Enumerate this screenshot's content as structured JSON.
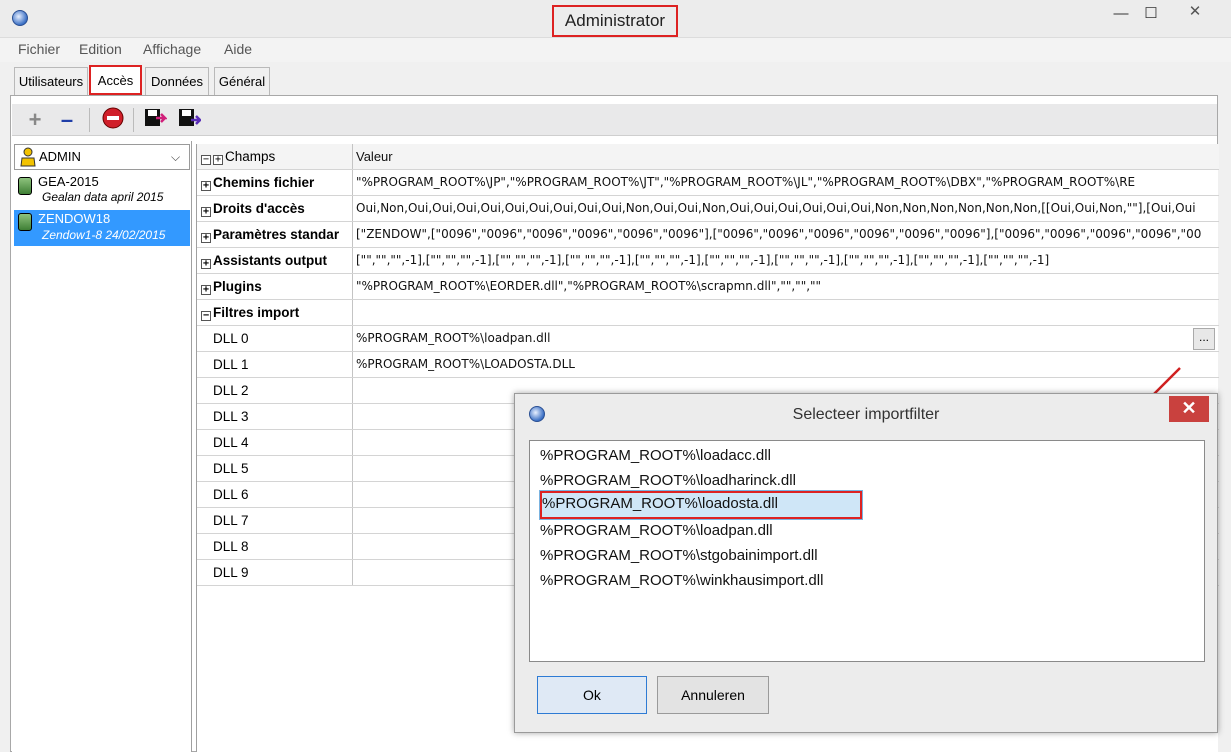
{
  "window": {
    "title": "Administrator",
    "minimize": "—",
    "maximize": "☐",
    "close": "✕"
  },
  "menu": [
    "Fichier",
    "Edition",
    "Affichage",
    "Aide"
  ],
  "tabs": [
    "Utilisateurs",
    "Accès",
    "Données",
    "Général"
  ],
  "toolbar": {
    "add": "+",
    "remove": "–",
    "stop": "⛔",
    "export1": "💾",
    "export2": "💾"
  },
  "left_panel": {
    "user": "ADMIN",
    "databases": [
      {
        "name": "GEA-2015",
        "sub": "Gealan data april 2015"
      },
      {
        "name": "ZENDOW18",
        "sub": "Zendow1-8 24/02/2015"
      }
    ]
  },
  "grid": {
    "header_field": "Champs",
    "header_value": "Valeur",
    "rows": [
      {
        "field": "Chemins fichier",
        "value": "\"%PROGRAM_ROOT%\\JP\",\"%PROGRAM_ROOT%\\JT\",\"%PROGRAM_ROOT%\\JL\",\"%PROGRAM_ROOT%\\DBX\",\"%PROGRAM_ROOT%\\RE"
      },
      {
        "field": "Droits d'accès",
        "value": "Oui,Non,Oui,Oui,Oui,Oui,Oui,Oui,Oui,Oui,Oui,Non,Oui,Oui,Non,Oui,Oui,Oui,Oui,Oui,Oui,Non,Non,Non,Non,Non,Non,[[Oui,Oui,Non,\"\"],[Oui,Oui"
      },
      {
        "field": "Paramètres standar",
        "value": "[\"ZENDOW\",[\"0096\",\"0096\",\"0096\",\"0096\",\"0096\",\"0096\"],[\"0096\",\"0096\",\"0096\",\"0096\",\"0096\",\"0096\"],[\"0096\",\"0096\",\"0096\",\"0096\",\"00"
      },
      {
        "field": "Assistants output",
        "value": "[\"\",\"\",\"\",-1],[\"\",\"\",\"\",-1],[\"\",\"\",\"\",-1],[\"\",\"\",\"\",-1],[\"\",\"\",\"\",-1],[\"\",\"\",\"\",-1],[\"\",\"\",\"\",-1],[\"\",\"\",\"\",-1],[\"\",\"\",\"\",-1],[\"\",\"\",\"\",-1]"
      },
      {
        "field": "Plugins",
        "value": "\"%PROGRAM_ROOT%\\EORDER.dll\",\"%PROGRAM_ROOT%\\scrapmn.dll\",\"\",\"\",\"\""
      },
      {
        "field": "Filtres import",
        "value": ""
      }
    ],
    "dlls": [
      {
        "field": "DLL 0",
        "value": "%PROGRAM_ROOT%\\loadpan.dll"
      },
      {
        "field": "DLL 1",
        "value": "%PROGRAM_ROOT%\\LOADOSTA.DLL"
      },
      {
        "field": "DLL 2",
        "value": ""
      },
      {
        "field": "DLL 3",
        "value": ""
      },
      {
        "field": "DLL 4",
        "value": ""
      },
      {
        "field": "DLL 5",
        "value": ""
      },
      {
        "field": "DLL 6",
        "value": ""
      },
      {
        "field": "DLL 7",
        "value": ""
      },
      {
        "field": "DLL 8",
        "value": ""
      },
      {
        "field": "DLL 9",
        "value": ""
      }
    ],
    "ellipsis": "..."
  },
  "dialog": {
    "title": "Selecteer importfilter",
    "close": "✕",
    "items": [
      "%PROGRAM_ROOT%\\loadacc.dll",
      "%PROGRAM_ROOT%\\loadharinck.dll",
      "%PROGRAM_ROOT%\\loadosta.dll",
      "%PROGRAM_ROOT%\\loadpan.dll",
      "%PROGRAM_ROOT%\\stgobainimport.dll",
      "%PROGRAM_ROOT%\\winkhausimport.dll"
    ],
    "selected_index": 2,
    "ok": "Ok",
    "cancel": "Annuleren"
  }
}
